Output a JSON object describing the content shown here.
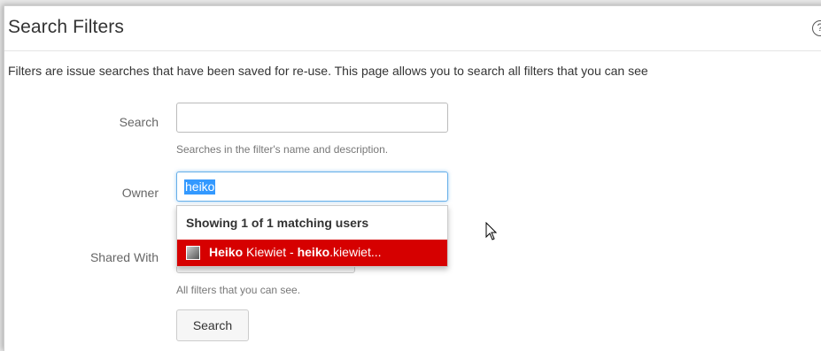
{
  "page": {
    "title": "Search Filters",
    "help_icon": "?",
    "description": "Filters are issue searches that have been saved for re-use. This page allows you to search all filters that you can see"
  },
  "form": {
    "search_label": "Search",
    "search_value": "",
    "search_hint": "Searches in the filter's name and description.",
    "owner_label": "Owner",
    "owner_value": "heiko",
    "shared_label": "Shared With",
    "shared_hint": "All filters that you can see.",
    "submit_label": "Search"
  },
  "owner_dropdown": {
    "header": "Showing 1 of 1 matching users",
    "items": [
      {
        "name_bold": "Heiko",
        "name_rest": " Kiewiet - ",
        "user_bold": "heiko",
        "user_rest": ".kiewiet..."
      }
    ]
  },
  "colors": {
    "selected_item_bg": "#d60000",
    "text_selection": "#3399ff",
    "focus_border": "#66afe9"
  }
}
